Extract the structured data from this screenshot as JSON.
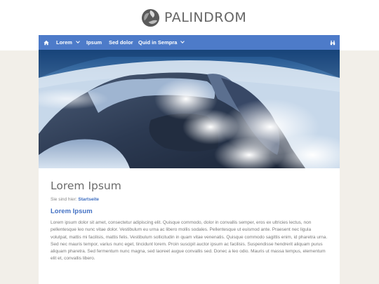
{
  "brand": {
    "name": "PALINDROM",
    "logo_icon": "tri-swirl-logo-icon"
  },
  "colors": {
    "nav_bg": "#4d7bc9",
    "accent": "#4472c4",
    "side_bg": "#f2efe9",
    "text": "#7a7a7a"
  },
  "nav": {
    "home_icon": "home-icon",
    "items": [
      {
        "label": "Lorem",
        "has_dropdown": true
      },
      {
        "label": "Ipsum",
        "has_dropdown": false
      },
      {
        "label": "Sed dolor",
        "has_dropdown": false
      },
      {
        "label": "Quid in Sempra",
        "has_dropdown": true
      }
    ],
    "search_icon": "search-binoculars-icon"
  },
  "hero": {
    "image": "snowy-volcano-aerial-photo"
  },
  "content": {
    "title": "Lorem Ipsum",
    "breadcrumb_prefix": "Sie sind hier:",
    "breadcrumb_link": "Startseite",
    "section_heading": "Lorem Ipsum",
    "paragraph": "Lorem ipsum dolor sit amet, consectetur adipiscing elit. Quisque commodo, dolor in convallis semper, eros ex ultricies lectus, non pellentesque leo nunc vitae dolor. Vestibulum eu urna ac libero mollis sodales. Pellentesque ut euismod ante. Praesent nec ligula volutpat, mattis mi facilisis, mattis felis. Vestibulum sollicitudin in quam vitae venenatis. Quisque commodo sagittis enim, id pharetra urna. Sed nec mauris tempor, varius nunc eget, tincidunt lorem. Proin suscipit auctor ipsum ac facilisis. Suspendisse hendrerit aliquam purus aliquam pharetra. Sed fermentum nunc magna, sed laoreet augue convallis sed. Donec a leo odio. Mauris ut massa tempus, elementum elit et, convallis libero."
  }
}
